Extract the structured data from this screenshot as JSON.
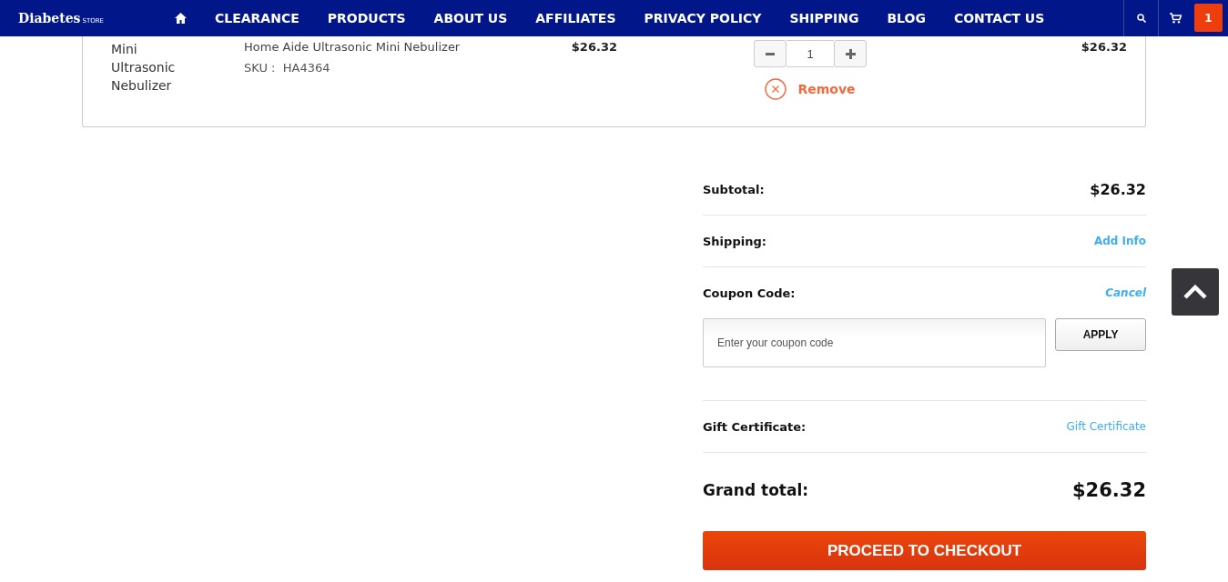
{
  "header": {
    "logo": {
      "name": "Diabetes",
      "suffix": "STORE"
    },
    "nav": [
      {
        "label": "CLEARANCE"
      },
      {
        "label": "PRODUCTS"
      },
      {
        "label": "ABOUT US"
      },
      {
        "label": "AFFILIATES"
      },
      {
        "label": "PRIVACY POLICY"
      },
      {
        "label": "SHIPPING"
      },
      {
        "label": "BLOG"
      },
      {
        "label": "CONTACT US"
      }
    ],
    "cart_count": "1"
  },
  "cart_item": {
    "image_alt": "Mini Ultrasonic Nebulizer",
    "title": "Home Aide Ultrasonic Mini Nebulizer",
    "sku_label": "SKU :",
    "sku": "HA4364",
    "price": "$26.32",
    "quantity": "1",
    "remove": "Remove",
    "total": "$26.32"
  },
  "summary": {
    "subtotal_label": "Subtotal:",
    "subtotal": "$26.32",
    "shipping_label": "Shipping:",
    "shipping_link": "Add Info",
    "coupon_label": "Coupon Code:",
    "coupon_cancel": "Cancel",
    "coupon_placeholder": "Enter your coupon code",
    "apply": "APPLY",
    "gift_label": "Gift Certificate:",
    "gift_link": "Gift Certificate",
    "grand_label": "Grand total:",
    "grand_total": "$26.32",
    "checkout": "PROCEED TO CHECKOUT"
  }
}
